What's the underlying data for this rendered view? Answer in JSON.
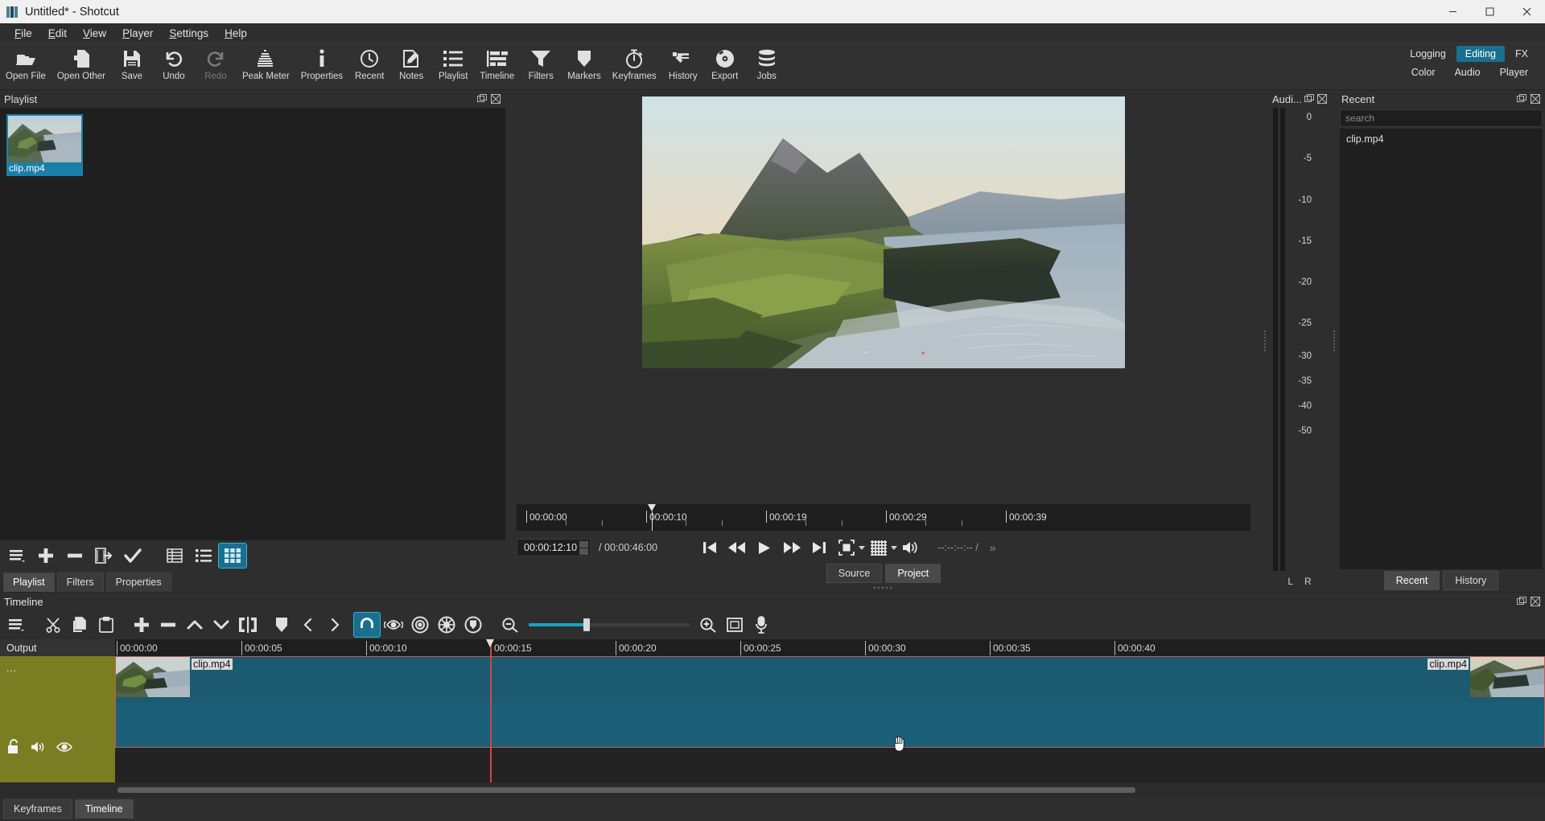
{
  "window": {
    "title": "Untitled* - Shotcut",
    "controls": {
      "minimize": "minimize-icon",
      "maximize": "maximize-icon",
      "close": "close-icon"
    }
  },
  "menubar": [
    {
      "label": "File",
      "mnemonic": "F"
    },
    {
      "label": "Edit",
      "mnemonic": "E"
    },
    {
      "label": "View",
      "mnemonic": "V"
    },
    {
      "label": "Player",
      "mnemonic": "P"
    },
    {
      "label": "Settings",
      "mnemonic": "S"
    },
    {
      "label": "Help",
      "mnemonic": "H"
    }
  ],
  "toolbar": {
    "items": [
      {
        "label": "Open File",
        "icon": "folder-open-icon",
        "disabled": false
      },
      {
        "label": "Open Other",
        "icon": "open-other-icon",
        "disabled": false
      },
      {
        "label": "Save",
        "icon": "save-disk-icon",
        "disabled": false
      },
      {
        "label": "Undo",
        "icon": "undo-arrow-icon",
        "disabled": false
      },
      {
        "label": "Redo",
        "icon": "redo-arrow-icon",
        "disabled": true
      },
      {
        "label": "Peak Meter",
        "icon": "peak-meter-icon",
        "disabled": false
      },
      {
        "label": "Properties",
        "icon": "info-icon",
        "disabled": false
      },
      {
        "label": "Recent",
        "icon": "clock-icon",
        "disabled": false
      },
      {
        "label": "Notes",
        "icon": "note-pencil-icon",
        "disabled": false
      },
      {
        "label": "Playlist",
        "icon": "list-icon",
        "disabled": false
      },
      {
        "label": "Timeline",
        "icon": "timeline-icon",
        "disabled": false
      },
      {
        "label": "Filters",
        "icon": "funnel-icon",
        "disabled": false
      },
      {
        "label": "Markers",
        "icon": "marker-icon",
        "disabled": false
      },
      {
        "label": "Keyframes",
        "icon": "stopwatch-icon",
        "disabled": false
      },
      {
        "label": "History",
        "icon": "history-icon",
        "disabled": false
      },
      {
        "label": "Export",
        "icon": "export-disc-icon",
        "disabled": false
      },
      {
        "label": "Jobs",
        "icon": "jobs-stack-icon",
        "disabled": false
      }
    ],
    "layouts_row1": [
      {
        "label": "Logging",
        "active": false
      },
      {
        "label": "Editing",
        "active": true
      },
      {
        "label": "FX",
        "active": false
      }
    ],
    "layouts_row2": [
      {
        "label": "Color",
        "active": false
      },
      {
        "label": "Audio",
        "active": false
      },
      {
        "label": "Player",
        "active": false
      }
    ],
    "active_layout_color": "#1a6f8e"
  },
  "playlist": {
    "title": "Playlist",
    "items": [
      {
        "name": "clip.mp4",
        "selected": true
      }
    ],
    "toolbar": [
      {
        "name": "menu-icon",
        "label": "Playlist menu"
      },
      {
        "name": "plus-icon",
        "label": "Append"
      },
      {
        "name": "minus-icon",
        "label": "Remove"
      },
      {
        "name": "update-icon",
        "label": "Update"
      },
      {
        "name": "check-icon",
        "label": "Select"
      },
      {
        "name": "view-details-icon",
        "label": "Detail view"
      },
      {
        "name": "view-list-icon",
        "label": "List view"
      },
      {
        "name": "view-tiles-icon",
        "label": "Tiles view",
        "active": true
      }
    ],
    "tabs": [
      {
        "label": "Playlist",
        "selected": true
      },
      {
        "label": "Filters",
        "selected": false
      },
      {
        "label": "Properties",
        "selected": false
      }
    ]
  },
  "player": {
    "ruler_labels": [
      "00:00:00",
      "00:00:10",
      "00:00:19",
      "00:00:29",
      "00:00:39"
    ],
    "position": "00:00:12:10",
    "duration": "00:00:46:00",
    "duration_prefix": "/",
    "in_out": "--:--:--:-- /",
    "overflow": "»",
    "transport": [
      {
        "name": "skip-to-start-button",
        "glyph": "skip-previous"
      },
      {
        "name": "rewind-button",
        "glyph": "rewind"
      },
      {
        "name": "play-button",
        "glyph": "play"
      },
      {
        "name": "fast-forward-button",
        "glyph": "fast-forward"
      },
      {
        "name": "skip-to-end-button",
        "glyph": "skip-next"
      },
      {
        "name": "toggle-zoom-button",
        "glyph": "zoom-fit"
      },
      {
        "name": "toggle-grid-button",
        "glyph": "grid"
      },
      {
        "name": "volume-button",
        "glyph": "volume"
      }
    ],
    "tabs": [
      {
        "label": "Source",
        "selected": false
      },
      {
        "label": "Project",
        "selected": true
      }
    ]
  },
  "audio_meter": {
    "title": "Audi...",
    "scale": [
      "0",
      "-5",
      "-10",
      "-15",
      "-20",
      "-25",
      "-30",
      "-35",
      "-40",
      "-50"
    ],
    "channels": [
      "L",
      "R"
    ]
  },
  "recent": {
    "title": "Recent",
    "search_placeholder": "search",
    "items": [
      {
        "label": "clip.mp4"
      }
    ],
    "tabs": [
      {
        "label": "Recent",
        "selected": true
      },
      {
        "label": "History",
        "selected": false
      }
    ]
  },
  "timeline": {
    "title": "Timeline",
    "toolbar": [
      {
        "name": "timeline-menu-icon",
        "label": "Timeline menu"
      },
      {
        "name": "cut-scissors-icon",
        "label": "Cut"
      },
      {
        "name": "copy-icon",
        "label": "Copy"
      },
      {
        "name": "paste-icon",
        "label": "Paste"
      },
      {
        "name": "append-plus-icon",
        "label": "Append"
      },
      {
        "name": "ripple-delete-minus-icon",
        "label": "Ripple Delete"
      },
      {
        "name": "lift-up-icon",
        "label": "Lift"
      },
      {
        "name": "overwrite-down-icon",
        "label": "Overwrite"
      },
      {
        "name": "split-icon",
        "label": "Split"
      },
      {
        "name": "marker-icon",
        "label": "Marker"
      },
      {
        "name": "previous-marker-icon",
        "label": "Previous Marker"
      },
      {
        "name": "next-marker-icon",
        "label": "Next Marker"
      },
      {
        "name": "snap-magnet-icon",
        "label": "Snap",
        "active": true
      },
      {
        "name": "scrub-eye-icon",
        "label": "Scrub While Dragging"
      },
      {
        "name": "ripple-icon",
        "label": "Ripple"
      },
      {
        "name": "ripple-all-tracks-icon",
        "label": "Ripple All Tracks"
      },
      {
        "name": "ripple-markers-icon",
        "label": "Ripple Markers"
      },
      {
        "name": "zoom-out-icon",
        "label": "Zoom Out"
      },
      {
        "name": "zoom-in-icon",
        "label": "Zoom In"
      },
      {
        "name": "zoom-fit-icon",
        "label": "Zoom Fit"
      },
      {
        "name": "record-audio-icon",
        "label": "Record Audio"
      }
    ],
    "output_label": "Output",
    "track": {
      "name": "...",
      "buttons": [
        {
          "name": "lock-track-icon",
          "label": "Lock"
        },
        {
          "name": "mute-track-icon",
          "label": "Mute"
        },
        {
          "name": "hide-track-icon",
          "label": "Hide"
        }
      ],
      "clip_label_left": "clip.mp4",
      "clip_label_right": "clip.mp4"
    },
    "ruler_labels": [
      "00:00:00",
      "00:00:05",
      "00:00:10",
      "00:00:15",
      "00:00:20",
      "00:00:25",
      "00:00:30",
      "00:00:35",
      "00:00:40"
    ],
    "tabs": [
      {
        "label": "Keyframes",
        "selected": false
      },
      {
        "label": "Timeline",
        "selected": true
      }
    ]
  },
  "colors": {
    "accent": "#1a6f8e",
    "track_head": "#7b7d22",
    "clip": "#1b5a70",
    "playhead": "#d64545",
    "slider": "#1aa0c8"
  }
}
